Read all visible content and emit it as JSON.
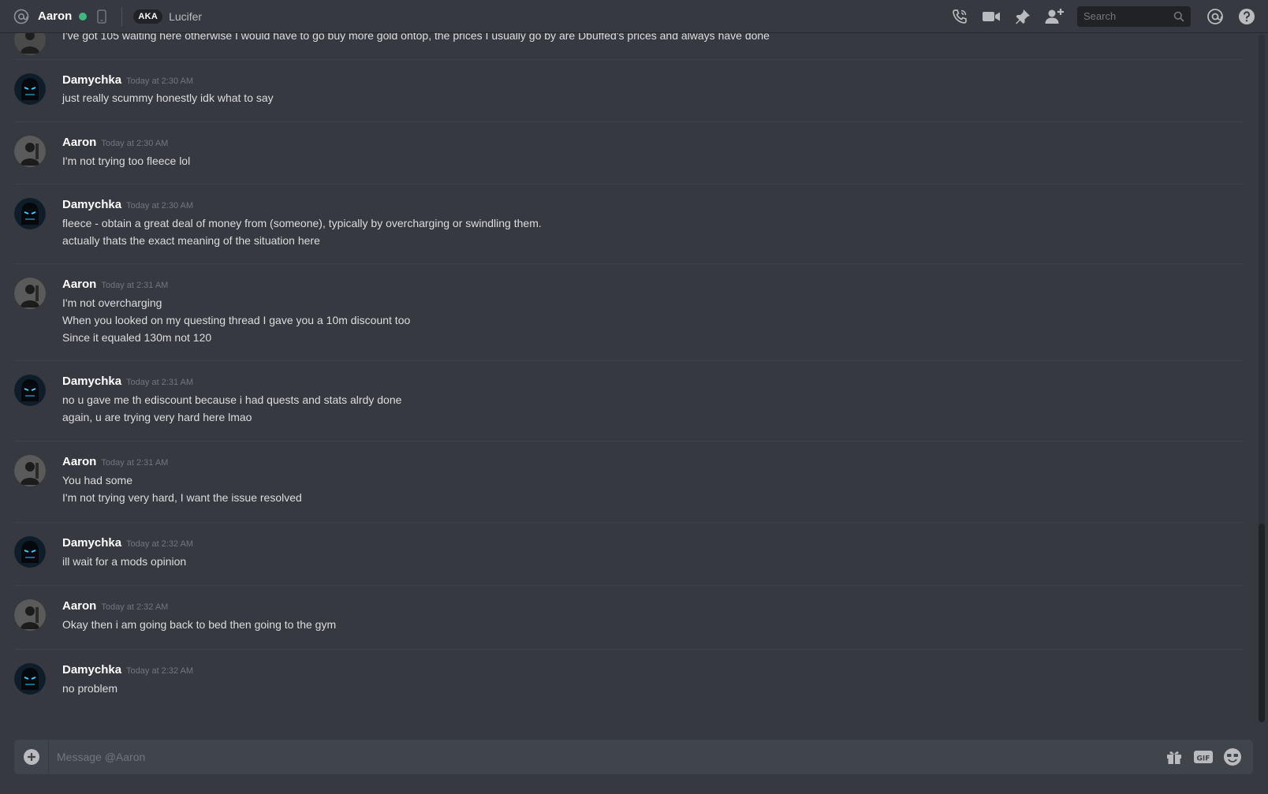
{
  "topbar": {
    "dm_name": "Aaron",
    "aka_badge": "AKA",
    "aka_name": "Lucifer",
    "search_placeholder": "Search",
    "icons": [
      "at-icon",
      "mobile-icon",
      "call-icon",
      "video-icon",
      "pin-icon",
      "add-friend-icon",
      "search-icon",
      "mentions-icon",
      "help-icon"
    ]
  },
  "colors": {
    "background": "#36393f",
    "online": "#43b581",
    "author": "#ffffff",
    "timestamp": "#72767d"
  },
  "messages": [
    {
      "author": "",
      "timestamp": "",
      "lines": [
        "I've got 105 waiting here otherwise I would have to go buy more gold ontop, the prices I usually go by are Dbuffed's prices and always have done"
      ]
    },
    {
      "author": "Damychka",
      "timestamp": "Today at 2:30 AM",
      "lines": [
        "just really scummy honestly idk what to say"
      ]
    },
    {
      "author": "Aaron",
      "timestamp": "Today at 2:30 AM",
      "lines": [
        "I'm not trying too fleece lol"
      ]
    },
    {
      "author": "Damychka",
      "timestamp": "Today at 2:30 AM",
      "lines": [
        "fleece - obtain a great deal of money from (someone), typically by overcharging or swindling them.",
        "actually thats the exact meaning of the situation here"
      ]
    },
    {
      "author": "Aaron",
      "timestamp": "Today at 2:31 AM",
      "lines": [
        "I'm not overcharging",
        "When you looked on my questing thread I gave you a 10m discount too",
        "Since it equaled 130m not 120"
      ]
    },
    {
      "author": "Damychka",
      "timestamp": "Today at 2:31 AM",
      "lines": [
        "no u gave me th ediscount because i had quests and stats alrdy done",
        "again, u are trying very hard here lmao"
      ]
    },
    {
      "author": "Aaron",
      "timestamp": "Today at 2:31 AM",
      "lines": [
        "You had some",
        "I'm not trying very hard, I want the issue resolved"
      ]
    },
    {
      "author": "Damychka",
      "timestamp": "Today at 2:32 AM",
      "lines": [
        "ill wait for a mods opinion"
      ]
    },
    {
      "author": "Aaron",
      "timestamp": "Today at 2:32 AM",
      "lines": [
        "Okay then i am going back to bed then going to the gym"
      ]
    },
    {
      "author": "Damychka",
      "timestamp": "Today at 2:32 AM",
      "lines": [
        "no problem"
      ]
    }
  ],
  "composer": {
    "placeholder": "Message @Aaron",
    "icons": [
      "add-attachment-icon",
      "gift-icon",
      "gif-icon",
      "emoji-icon"
    ]
  }
}
